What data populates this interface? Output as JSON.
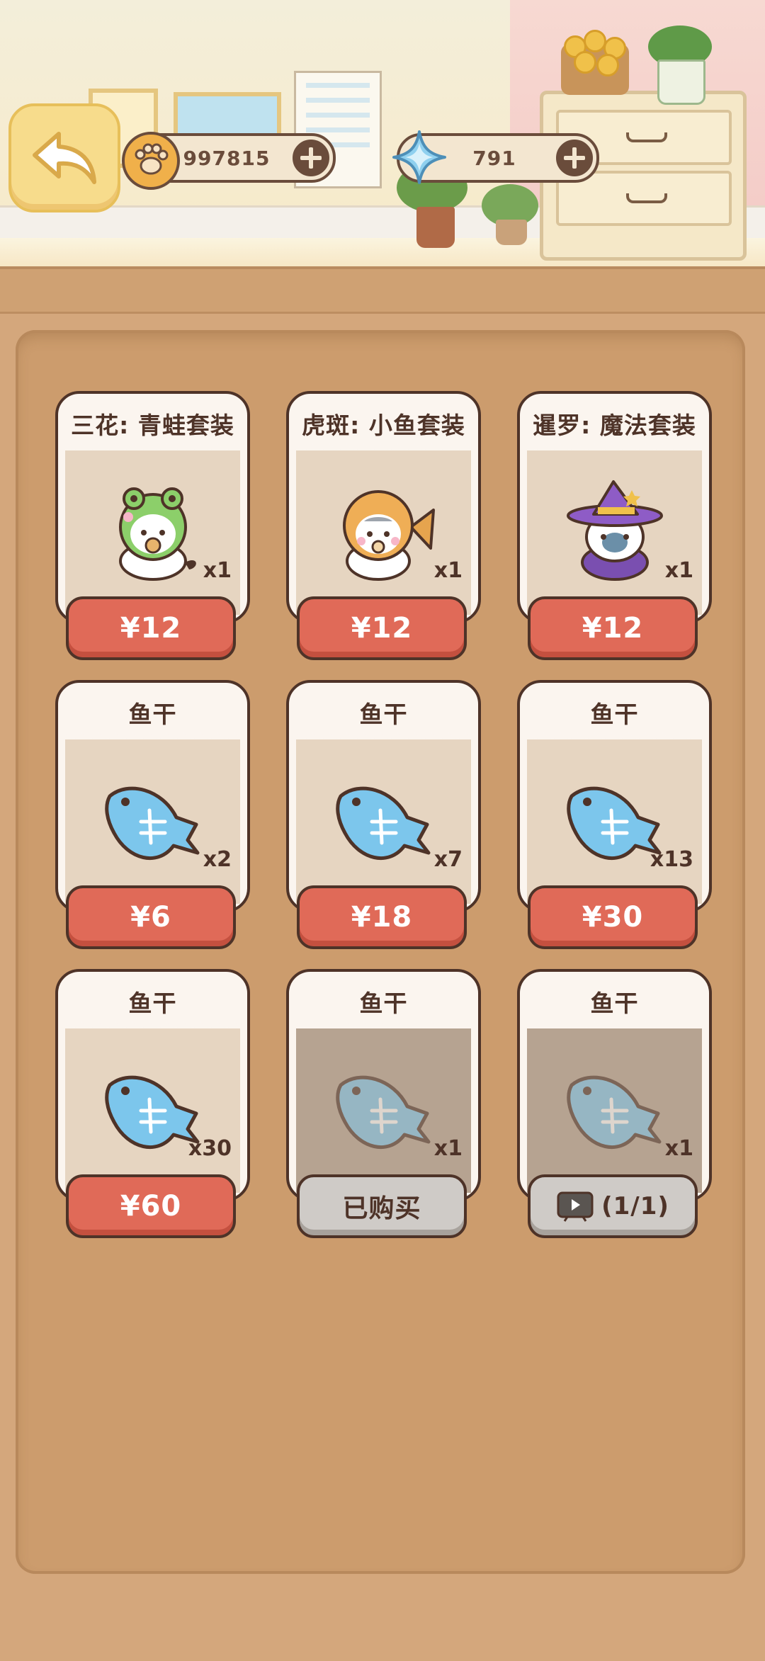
{
  "header": {
    "paw_balance": "997815",
    "gem_balance": "791"
  },
  "cards": [
    {
      "title": "三花: 青蛙套装",
      "qty": "x1",
      "button": "¥12",
      "state": "buy",
      "art": "frog-cat"
    },
    {
      "title": "虎斑: 小鱼套装",
      "qty": "x1",
      "button": "¥12",
      "state": "buy",
      "art": "fish-cat"
    },
    {
      "title": "暹罗: 魔法套装",
      "qty": "x1",
      "button": "¥12",
      "state": "buy",
      "art": "witch-cat"
    },
    {
      "title": "鱼干",
      "qty": "x2",
      "button": "¥6",
      "state": "buy",
      "art": "fish"
    },
    {
      "title": "鱼干",
      "qty": "x7",
      "button": "¥18",
      "state": "buy",
      "art": "fish"
    },
    {
      "title": "鱼干",
      "qty": "x13",
      "button": "¥30",
      "state": "buy",
      "art": "fish"
    },
    {
      "title": "鱼干",
      "qty": "x30",
      "button": "¥60",
      "state": "buy",
      "art": "fish"
    },
    {
      "title": "鱼干",
      "qty": "x1",
      "button": "已购买",
      "state": "purchased",
      "art": "fish"
    },
    {
      "title": "鱼干",
      "qty": "x1",
      "button": "(1/1)",
      "state": "ad",
      "art": "fish"
    }
  ],
  "colors": {
    "buy_button": "#e06a58",
    "disabled_button": "#cfcbc7",
    "outline": "#4e3328"
  }
}
